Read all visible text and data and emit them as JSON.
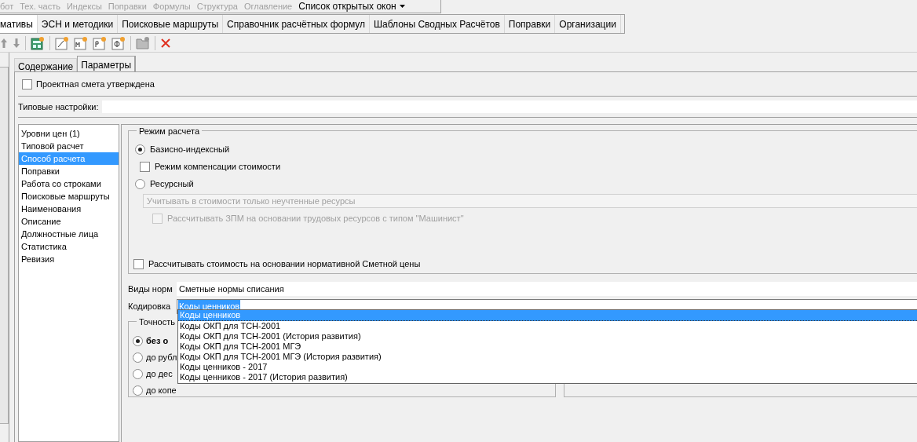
{
  "menu": [
    {
      "label": "бот",
      "disabled": true,
      "kind": "item"
    },
    {
      "label": "Тех. часть",
      "disabled": true,
      "kind": "item"
    },
    {
      "label": "Индексы",
      "disabled": true,
      "kind": "item"
    },
    {
      "label": "Поправки",
      "disabled": true,
      "kind": "item"
    },
    {
      "label": "Формулы",
      "disabled": true,
      "kind": "item"
    },
    {
      "label": "Структура",
      "disabled": true,
      "kind": "item"
    },
    {
      "label": "Оглавление",
      "disabled": true,
      "kind": "item"
    },
    {
      "label": "Список открытых окон",
      "disabled": false,
      "kind": "dropdown"
    }
  ],
  "tabs": [
    {
      "label": "мативы",
      "selected": true
    },
    {
      "label": "ЭСН и методики",
      "selected": false
    },
    {
      "label": "Поисковые маршруты",
      "selected": false
    },
    {
      "label": "Справочник расчётных формул",
      "selected": false
    },
    {
      "label": "Шаблоны Сводных Расчётов",
      "selected": false
    },
    {
      "label": "Поправки",
      "selected": false
    },
    {
      "label": "Организации",
      "selected": false
    }
  ],
  "sub_tabs": [
    {
      "label": "Содержание",
      "selected": false
    },
    {
      "label": "Параметры",
      "selected": true
    }
  ],
  "approved": {
    "label": "Проектная смета утверждена",
    "checked": false
  },
  "typical_settings": {
    "label": "Типовые настройки:"
  },
  "sections": [
    {
      "label": "Уровни цен (1)",
      "selected": false
    },
    {
      "label": "Типовой расчет",
      "selected": false
    },
    {
      "label": "Способ расчета",
      "selected": true
    },
    {
      "label": "Поправки",
      "selected": false
    },
    {
      "label": "Работа со строками",
      "selected": false
    },
    {
      "label": "Поисковые маршруты",
      "selected": false
    },
    {
      "label": "Наименования",
      "selected": false
    },
    {
      "label": "Описание",
      "selected": false
    },
    {
      "label": "Должностные лица",
      "selected": false
    },
    {
      "label": "Статистика",
      "selected": false
    },
    {
      "label": "Ревизия",
      "selected": false
    }
  ],
  "calc_mode": {
    "title": "Режим расчета",
    "items": [
      {
        "kind": "radio",
        "label": "Базисно-индексный",
        "selected": true,
        "disabled": false
      },
      {
        "kind": "checkbox",
        "label": "Режим компенсации стоимости",
        "checked": false,
        "disabled": false
      },
      {
        "kind": "radio",
        "label": "Ресурсный",
        "selected": false,
        "disabled": false
      },
      {
        "kind": "select",
        "value": "Учитывать в стоимости только неучтенные ресурсы",
        "disabled": true
      },
      {
        "kind": "checkbox",
        "label": "Рассчитывать ЗПМ на основании трудовых ресурсов с типом \"Машинист\"",
        "checked": false,
        "disabled": true
      }
    ]
  },
  "normative_price": {
    "label": "Рассчитывать стоимость на основании нормативной Сметной цены",
    "checked": false
  },
  "norm_types": {
    "label": "Виды норм",
    "value": "Сметные нормы списания"
  },
  "coding": {
    "label": "Кодировка",
    "value": "Коды ценников",
    "options": [
      {
        "label": "Коды ценников",
        "selected": true
      },
      {
        "label": "Коды ОКП для ТСН-2001",
        "selected": false
      },
      {
        "label": "Коды ОКП для ТСН-2001 (История развития)",
        "selected": false
      },
      {
        "label": "Коды ОКП для ТСН-2001 МГЭ",
        "selected": false
      },
      {
        "label": "Коды ОКП для ТСН-2001 МГЭ (История развития)",
        "selected": false
      },
      {
        "label": "Коды ценников - 2017",
        "selected": false
      },
      {
        "label": "Коды ценников - 2017 (История развития)",
        "selected": false
      }
    ]
  },
  "precision": {
    "title": "Точность",
    "options": [
      {
        "label": "без о",
        "selected": true
      },
      {
        "label": "до рубл",
        "selected": false
      },
      {
        "label": "до дес",
        "selected": false
      },
      {
        "label": "до копе",
        "selected": false
      }
    ]
  }
}
